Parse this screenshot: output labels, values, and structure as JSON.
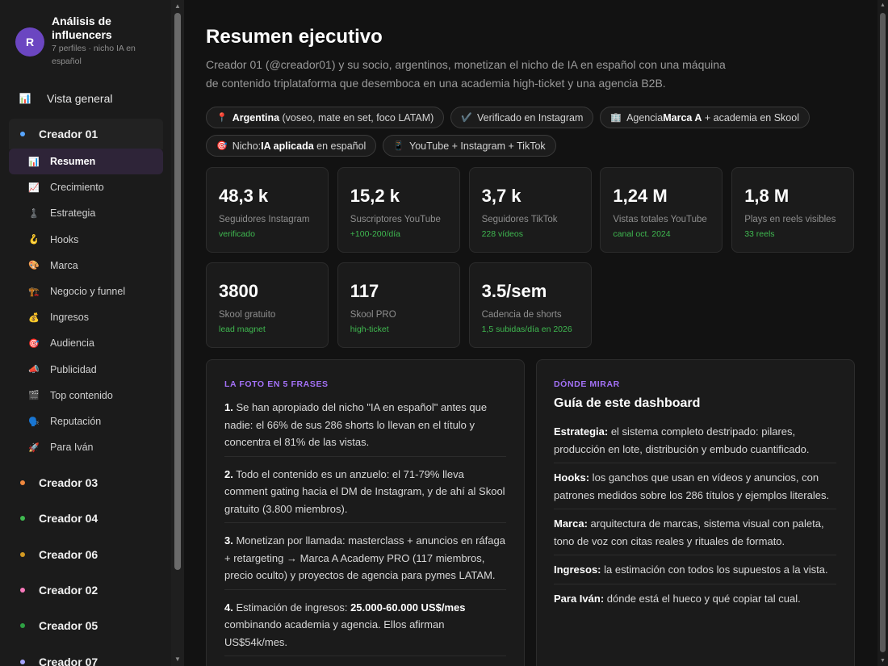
{
  "app": {
    "avatar_letter": "R",
    "title": "Análisis de influencers",
    "subtitle": "7 perfiles · nicho IA en español"
  },
  "sidebar": {
    "overview": {
      "icon": "📊",
      "label": "Vista general"
    },
    "active_group": {
      "label": "Creador 01",
      "color": "#58a6ff"
    },
    "subitems": [
      {
        "icon": "📊",
        "label": "Resumen"
      },
      {
        "icon": "📈",
        "label": "Crecimiento"
      },
      {
        "icon": "♟️",
        "label": "Estrategia"
      },
      {
        "icon": "🪝",
        "label": "Hooks"
      },
      {
        "icon": "🎨",
        "label": "Marca"
      },
      {
        "icon": "🏗️",
        "label": "Negocio y funnel"
      },
      {
        "icon": "💰",
        "label": "Ingresos"
      },
      {
        "icon": "🎯",
        "label": "Audiencia"
      },
      {
        "icon": "📣",
        "label": "Publicidad"
      },
      {
        "icon": "🎬",
        "label": "Top contenido"
      },
      {
        "icon": "🗣️",
        "label": "Reputación"
      },
      {
        "icon": "🚀",
        "label": "Para Iván"
      }
    ],
    "groups": [
      {
        "label": "Creador 03",
        "color": "#f0883e"
      },
      {
        "label": "Creador 04",
        "color": "#3fb950"
      },
      {
        "label": "Creador 06",
        "color": "#d29922"
      },
      {
        "label": "Creador 02",
        "color": "#f778ba"
      },
      {
        "label": "Creador 05",
        "color": "#2ea043"
      },
      {
        "label": "Creador 07",
        "color": "#a5a5ff"
      }
    ]
  },
  "main": {
    "title": "Resumen ejecutivo",
    "intro": "Creador 01 (@creador01) y su socio, argentinos, monetizan el nicho de IA en español con una máquina de contenido triplataforma que desemboca en una academia high-ticket y una agencia B2B.",
    "chips_row1": [
      {
        "icon": "📍",
        "bold": "Argentina",
        "pre": "",
        "post": " (voseo, mate en set, foco LATAM)"
      },
      {
        "icon": "✔️",
        "bold": "",
        "pre": "Verificado en Instagram",
        "post": ""
      },
      {
        "icon": "🏢",
        "bold": "Marca A",
        "pre": "Agencia ",
        "post": " + academia en Skool"
      }
    ],
    "chips_row2": [
      {
        "icon": "🎯",
        "bold": "IA aplicada",
        "pre": "Nicho: ",
        "post": " en español"
      },
      {
        "icon": "📱",
        "bold": "",
        "pre": "YouTube + Instagram + TikTok",
        "post": ""
      }
    ],
    "stats": [
      {
        "value": "48,3 k",
        "label": "Seguidores Instagram",
        "note": "verificado"
      },
      {
        "value": "15,2 k",
        "label": "Suscriptores YouTube",
        "note": "+100-200/día"
      },
      {
        "value": "3,7 k",
        "label": "Seguidores TikTok",
        "note": "228 vídeos"
      },
      {
        "value": "1,24 M",
        "label": "Vistas totales YouTube",
        "note": "canal oct. 2024"
      },
      {
        "value": "1,8 M",
        "label": "Plays en reels visibles",
        "note": "33 reels"
      },
      {
        "value": "3800",
        "label": "Skool gratuito",
        "note": "lead magnet"
      },
      {
        "value": "117",
        "label": "Skool PRO",
        "note": "high-ticket"
      },
      {
        "value": "3.5/sem",
        "label": "Cadencia de shorts",
        "note": "1,5 subidas/día en 2026"
      }
    ],
    "left_panel": {
      "kicker": "LA FOTO EN 5 FRASES",
      "items": [
        {
          "num": "1.",
          "a": " Se han apropiado del nicho \"IA en español\" antes que nadie: el 66% de sus 286 shorts lo llevan en el título y concentra el 81% de las vistas.",
          "bold": "",
          "b": ""
        },
        {
          "num": "2.",
          "a": " Todo el contenido es un anzuelo: el 71-79% lleva comment gating hacia el DM de Instagram, y de ahí al Skool gratuito (3.800 miembros).",
          "bold": "",
          "b": ""
        },
        {
          "num": "3.",
          "a": " Monetizan por llamada: masterclass + anuncios en ráfaga + retargeting → Marca A Academy PRO (117 miembros, precio oculto) y proyectos de agencia para pymes LATAM.",
          "bold": "",
          "b": ""
        },
        {
          "num": "4.",
          "a": " Estimación de ingresos: ",
          "bold": "25.000-60.000 US$/mes",
          "b": " combinando academia y agencia. Ellos afirman US$54k/mes."
        }
      ]
    },
    "right_panel": {
      "kicker": "DÓNDE MIRAR",
      "title": "Guía de este dashboard",
      "items": [
        {
          "bold": "Estrategia:",
          "text": " el sistema completo destripado: pilares, producción en lote, distribución y embudo cuantificado."
        },
        {
          "bold": "Hooks:",
          "text": " los ganchos que usan en vídeos y anuncios, con patrones medidos sobre los 286 títulos y ejemplos literales."
        },
        {
          "bold": "Marca:",
          "text": " arquitectura de marcas, sistema visual con paleta, tono de voz con citas reales y rituales de formato."
        },
        {
          "bold": "Ingresos:",
          "text": " la estimación con todos los supuestos a la vista."
        },
        {
          "bold": "Para Iván:",
          "text": " dónde está el hueco y qué copiar tal cual."
        }
      ]
    }
  }
}
